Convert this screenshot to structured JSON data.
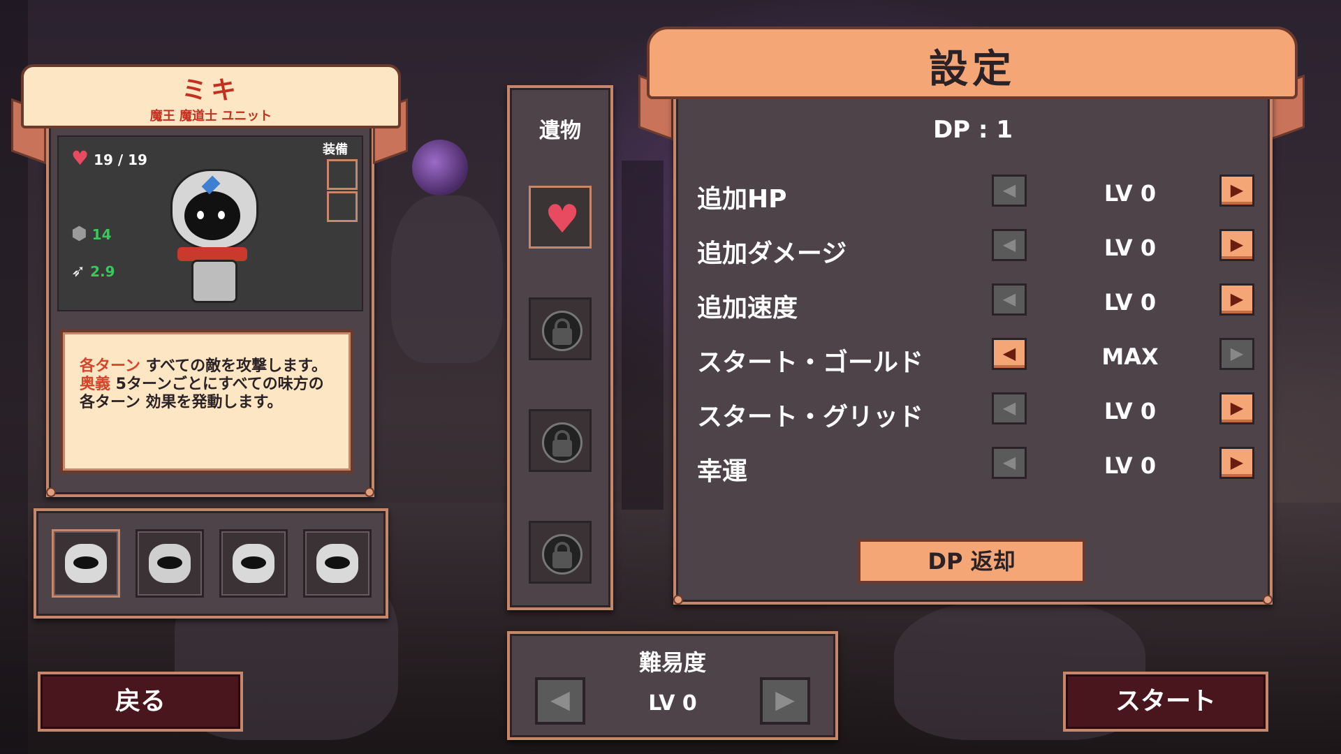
{
  "character": {
    "name": "ミキ",
    "class": "魔王 魔道士 ユニット",
    "hp": "19 / 19",
    "attack": "14",
    "speed": "2.9",
    "equip_label": "装備",
    "desc_kw1": "各ターン",
    "desc_text1": " すべての敵を攻撃します。",
    "desc_kw2": "奥義",
    "desc_text2": " 5ターンごとにすべての味方の各ターン 効果を発動します。"
  },
  "units": [
    "unit-1",
    "unit-2",
    "unit-3",
    "unit-4"
  ],
  "relics": {
    "title": "遺物"
  },
  "difficulty": {
    "title": "難易度",
    "value": "LV 0"
  },
  "settings": {
    "title": "設定",
    "dp": "DP : 1",
    "rows": [
      {
        "label": "追加HP",
        "value": "LV 0"
      },
      {
        "label": "追加ダメージ",
        "value": "LV 0"
      },
      {
        "label": "追加速度",
        "value": "LV 0"
      },
      {
        "label": "スタート・ゴールド",
        "value": "MAX"
      },
      {
        "label": "スタート・グリッド",
        "value": "LV 0"
      },
      {
        "label": "幸運",
        "value": "LV 0"
      }
    ],
    "dp_return": "DP 返却"
  },
  "buttons": {
    "back": "戻る",
    "start": "スタート"
  },
  "colors": {
    "accent": "#f4a677",
    "frame": "#c7876a",
    "panel": "#4e4348",
    "keyword": "#d8432b"
  }
}
